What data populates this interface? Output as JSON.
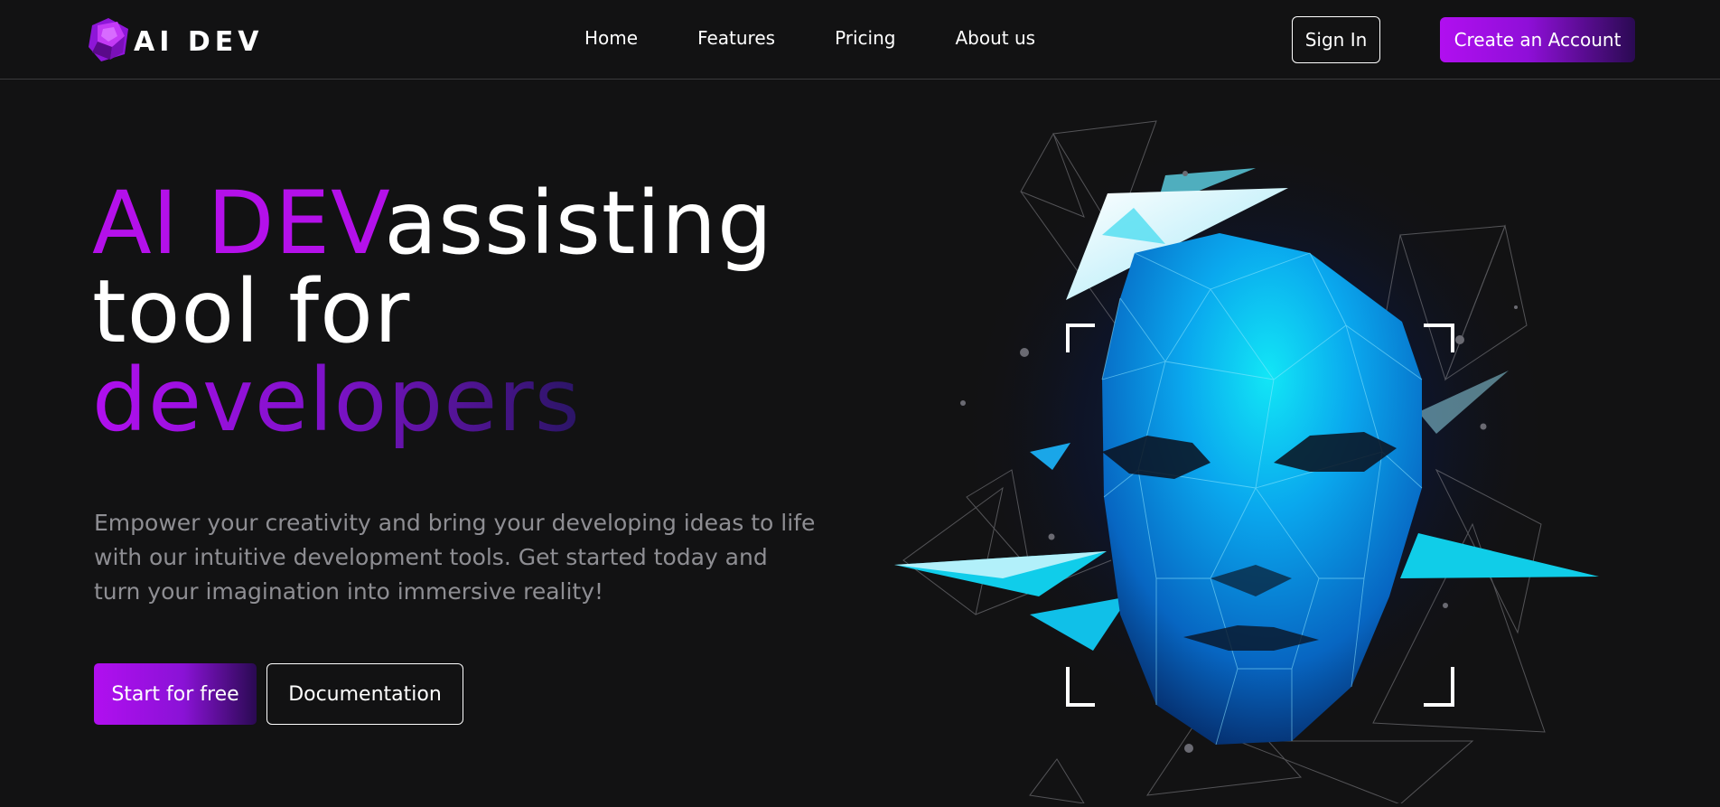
{
  "brand": {
    "name": "AI DEV"
  },
  "nav": {
    "items": [
      {
        "label": "Home"
      },
      {
        "label": "Features"
      },
      {
        "label": "Pricing"
      },
      {
        "label": "About us"
      }
    ],
    "sign_in_label": "Sign In",
    "create_account_label": "Create an Account"
  },
  "hero": {
    "title_brand": "AI DEV",
    "title_middle": "assisting tool for",
    "title_last": "developers",
    "description": "Empower your creativity and bring your developing ideas to life with our intuitive development tools. Get started today and turn your imagination into immersive reality!",
    "start_button_label": "Start for free",
    "docs_button_label": "Documentation"
  },
  "illustration": {
    "icon": "low-poly-face-icon"
  },
  "colors": {
    "background": "#121213",
    "accent_purple": "#b410ea",
    "accent_dark": "#2a0a52",
    "face_cyan": "#10c8f0",
    "face_blue": "#0a4fa0",
    "description_gray": "#8e8e93"
  }
}
